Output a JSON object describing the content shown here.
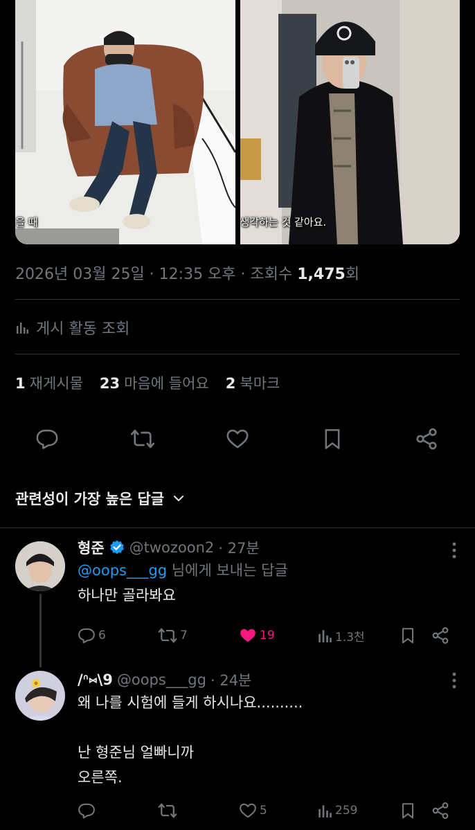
{
  "media": {
    "left_caption": "을 때",
    "right_caption": "생각하는 것 같아요."
  },
  "post": {
    "datetime": "2026년 03월 25일 · 12:35 오후 · 조회수",
    "views": "1,475",
    "views_suffix": "회",
    "activity_label": "게시 활동 조회",
    "reposts_count": "1",
    "reposts_label": "재게시물",
    "likes_count": "23",
    "likes_label": "마음에 들어요",
    "bookmarks_count": "2",
    "bookmarks_label": "북마크"
  },
  "sort": {
    "label": "관련성이 가장 높은 답글"
  },
  "replies": [
    {
      "name": "형준",
      "handle": "@twozoon2",
      "time": "· 27분",
      "replying_mention": "@oops___gg",
      "replying_suffix": " 님에게 보내는 답글",
      "lines": [
        "하나만 골라봐요"
      ],
      "replies_count": "6",
      "reposts_count": "7",
      "likes_count": "19",
      "views_count": "1.3천"
    },
    {
      "name": "/ᐢ⑅\\9",
      "handle": "@oops___gg",
      "time": "· 24분",
      "lines": [
        "왜 나를 시험에 들게 하시나요..........",
        "",
        "난 형준님 얼빠니까",
        "오른쪽."
      ],
      "replies_count": "",
      "reposts_count": "",
      "likes_count": "5",
      "views_count": "259"
    }
  ],
  "colors": {
    "background": "#000000",
    "text": "#e7e9ea",
    "muted": "#71767b",
    "link": "#1d9bf0",
    "like": "#f91880",
    "divider": "#2f3336"
  },
  "icons": [
    "bar-chart-icon",
    "reply-icon",
    "repost-icon",
    "heart-icon",
    "bookmark-icon",
    "share-icon",
    "chevron-down-icon",
    "verified-badge-icon",
    "more-icon"
  ]
}
